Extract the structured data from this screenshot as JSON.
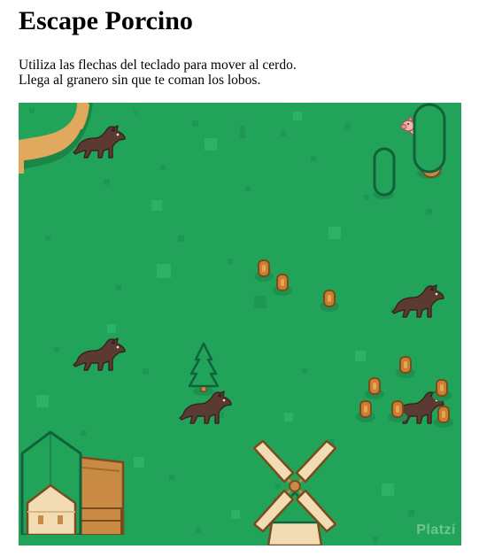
{
  "page": {
    "title": "Escape Porcino",
    "instructions": [
      "Utiliza las flechas del teclado para mover al cerdo.",
      "Llega al granero sin que te coman los lobos."
    ]
  },
  "game": {
    "icons": {
      "player": "pig-icon",
      "enemy": "wolf-icon",
      "goal": "barn-icon",
      "decor": [
        "windmill-icon",
        "tree-icon",
        "stump-icon",
        "dirt-path"
      ]
    },
    "entity_counts": {
      "wolves": 5,
      "pig": 1
    },
    "colors": {
      "grass": "#22a35a",
      "grass_light": "#2cb466",
      "grass_dark": "#1b8f4d",
      "path": "#e0a95e",
      "path_edge": "#1c8647",
      "wolf": "#5b3a32",
      "pig": "#f4b3ae",
      "barn_roof": "#1f8b4c",
      "barn_wall": "#c98a44",
      "windmill_sail": "#f1dcb4"
    },
    "watermark": "Platzi"
  }
}
